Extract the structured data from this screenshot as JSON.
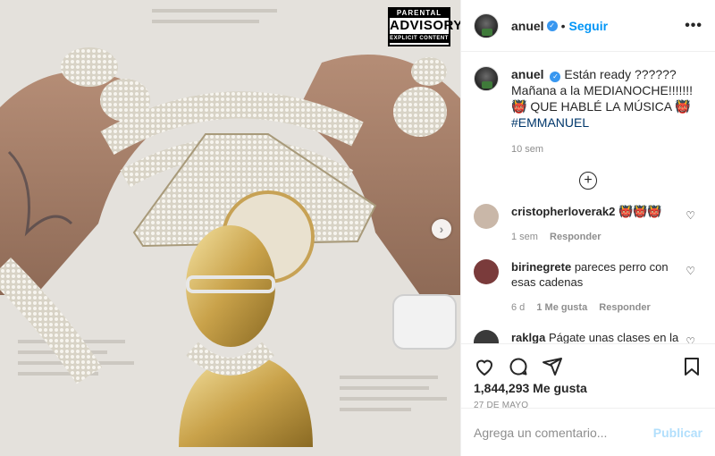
{
  "header": {
    "username": "anuel",
    "follow_label": "Seguir",
    "more_label": "•••"
  },
  "media": {
    "advisory": {
      "line1": "PARENTAL",
      "line2": "ADVISORY",
      "line3": "EXPLICIT CONTENT"
    },
    "next_label": "›"
  },
  "caption": {
    "username": "anuel",
    "text": "Están ready ?????? Mañana a la MEDIANOCHE!!!!!!! 👹 QUE HABLÉ LA MÚSICA 👹 ",
    "hashtag": "#EMMANUEL",
    "time": "10 sem"
  },
  "comments": [
    {
      "username": "cristopherloverak2",
      "text": "👹👹👹",
      "time": "1 sem",
      "likes": "",
      "reply_label": "Responder",
      "avatar_color": "#c9b7a8"
    },
    {
      "username": "birinegrete",
      "text": "pareces perro con esas cadenas",
      "time": "6 d",
      "likes": "1 Me gusta",
      "reply_label": "Responder",
      "avatar_color": "#7a3b3b"
    },
    {
      "username": "raklga",
      "text": "Págate unas clases en la universidad a ver si aprendes",
      "time": "",
      "likes": "",
      "reply_label": "",
      "avatar_color": "#3a3a3a"
    }
  ],
  "actions": {
    "likes": "1,844,293 Me gusta",
    "date": "27 DE MAYO"
  },
  "add_comment": {
    "placeholder": "Agrega un comentario...",
    "publish_label": "Publicar"
  },
  "colors": {
    "accent": "#0095f6",
    "verified": "#3897f0",
    "muted": "#8e8e8e",
    "publish_disabled": "#b2dffc"
  },
  "icons": [
    "verified-icon",
    "more-icon",
    "next-icon",
    "load-more-icon",
    "heart-icon",
    "comment-icon",
    "share-icon",
    "save-icon"
  ]
}
